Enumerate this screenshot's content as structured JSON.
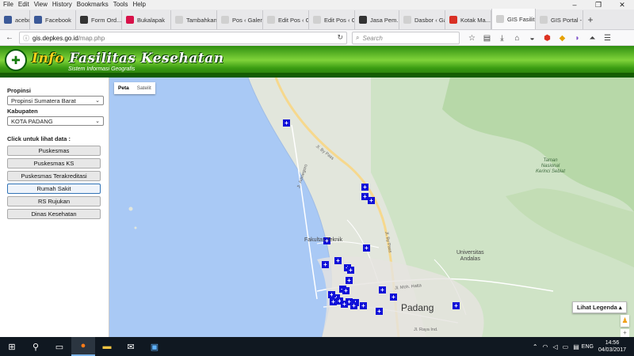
{
  "menubar": {
    "items": [
      "File",
      "Edit",
      "View",
      "History",
      "Bookmarks",
      "Tools",
      "Help"
    ]
  },
  "window_controls": [
    "–",
    "❐",
    "✕"
  ],
  "tabs": [
    {
      "label": "acebook",
      "color": "#3b5998"
    },
    {
      "label": "Facebook",
      "color": "#3b5998"
    },
    {
      "label": "Form Ord...",
      "color": "#333333"
    },
    {
      "label": "Bukalapak",
      "color": "#d71149"
    },
    {
      "label": "Tambahkan P...",
      "color": "#d0d0d0"
    },
    {
      "label": "Pos ‹ Galerigi...",
      "color": "#d0d0d0"
    },
    {
      "label": "Edit Pos ‹ Gal...",
      "color": "#d0d0d0"
    },
    {
      "label": "Edit Pos ‹ Gal...",
      "color": "#d0d0d0"
    },
    {
      "label": "Jasa Pem...",
      "color": "#333333"
    },
    {
      "label": "Dasbor ‹ Gale...",
      "color": "#d0d0d0"
    },
    {
      "label": "Kotak Ma...",
      "color": "#d93025"
    },
    {
      "label": "GIS Fasilit...",
      "color": "#d0d0d0",
      "active": true
    },
    {
      "label": "GIS Portal - F...",
      "color": "#d0d0d0"
    }
  ],
  "new_tab_label": "+",
  "address": {
    "domain": "gis.depkes.go.id",
    "path": "/map.php"
  },
  "search": {
    "placeholder": "Search"
  },
  "header": {
    "title_first": "Info",
    "title_rest": " Fasilitas Kesehatan",
    "subtitle": "Sistem Informasi Geografis"
  },
  "sidebar": {
    "province_label": "Propinsi",
    "province_value": "Propinsi Sumatera Barat",
    "regency_label": "Kabupaten",
    "regency_value": "KOTA PADANG",
    "click_label": "Click untuk lihat data :",
    "buttons": [
      {
        "label": "Puskesmas",
        "selected": false
      },
      {
        "label": "Puskesmas KS",
        "selected": false
      },
      {
        "label": "Puskesmas Terakreditasi",
        "selected": false
      },
      {
        "label": "Rumah Sakit",
        "selected": true
      },
      {
        "label": "RS Rujukan",
        "selected": false
      },
      {
        "label": "Dinas Kesehatan",
        "selected": false
      }
    ]
  },
  "map": {
    "toggle_map": "Peta",
    "toggle_satellite": "Satelit",
    "city": "Padang",
    "labels": {
      "fakultas": "Fakultas Teknik",
      "universitas": "Universitas\nAndalas",
      "park": "Taman\nNasional\nKerinci Seblat",
      "road_bypass_1": "Jl. By Pass",
      "road_bypass_2": "Jl. By Pass",
      "road_adinegoro": "Jl. Adinegoro",
      "road_moh_hatta": "Jl. Moh. Hatta",
      "road_raya": "Jl. Raya Ind."
    },
    "legend_button": "Lihat Legenda ▴",
    "marker_color": "#1010d8"
  },
  "taskbar": {
    "language": "ENG",
    "time": "14:56",
    "date": "04/03/2017"
  }
}
